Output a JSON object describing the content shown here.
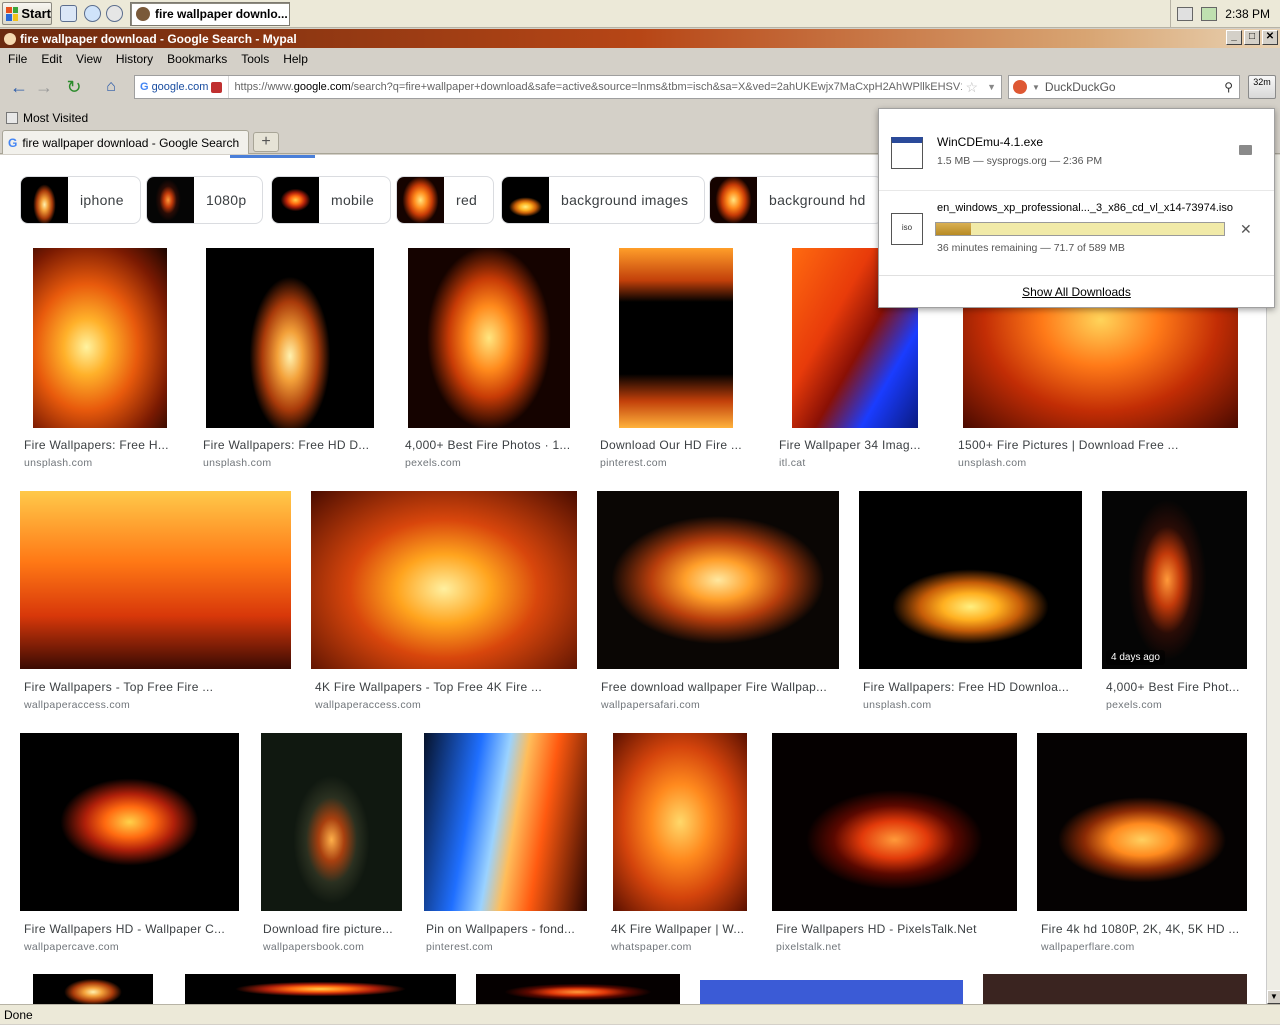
{
  "taskbar": {
    "start_label": "Start",
    "task_label": "fire wallpaper downlo...",
    "clock": "2:38 PM"
  },
  "window": {
    "title": "fire wallpaper download - Google Search - Mypal",
    "min": "_",
    "max": "□",
    "close": "✕"
  },
  "menu": {
    "file": "File",
    "edit": "Edit",
    "view": "View",
    "history": "History",
    "bookmarks": "Bookmarks",
    "tools": "Tools",
    "help": "Help"
  },
  "nav": {
    "site_label": "google.com",
    "url_prefix": "https://www.",
    "url_host": "google.com",
    "url_rest": "/search?q=fire+wallpaper+download&safe=active&source=lnms&tbm=isch&sa=X&ved=2ahUKEwjx7MaCxpH2AhWPllkEHSV1(",
    "search_engine": "DuckDuckGo",
    "download_indicator": "32m"
  },
  "bookmarks": {
    "most_visited": "Most Visited"
  },
  "tabs": {
    "active_label": "fire wallpaper download - Google Search",
    "new_tab": "+"
  },
  "chips": [
    "iphone",
    "1080p",
    "mobile",
    "red",
    "background images",
    "background hd"
  ],
  "results": [
    {
      "caption": "Fire Wallpapers: Free H...",
      "source": "unsplash.com"
    },
    {
      "caption": "Fire Wallpapers: Free HD D...",
      "source": "unsplash.com"
    },
    {
      "caption": "4,000+ Best Fire Photos · 1...",
      "source": "pexels.com"
    },
    {
      "caption": "Download Our HD Fire ...",
      "source": "pinterest.com"
    },
    {
      "caption": "Fire Wallpaper 34 Imag...",
      "source": "itl.cat"
    },
    {
      "caption": "1500+ Fire Pictures | Download Free ...",
      "source": "unsplash.com"
    },
    {
      "caption": "Fire Wallpapers - Top Free Fire ...",
      "source": "wallpaperaccess.com"
    },
    {
      "caption": "4K Fire Wallpapers - Top Free 4K Fire ...",
      "source": "wallpaperaccess.com"
    },
    {
      "caption": "Free download wallpaper Fire Wallpap...",
      "source": "wallpapersafari.com"
    },
    {
      "caption": "Fire Wallpapers: Free HD Downloa...",
      "source": "unsplash.com"
    },
    {
      "caption": "4,000+ Best Fire Phot...",
      "source": "pexels.com",
      "badge": "4 days ago"
    },
    {
      "caption": "Fire Wallpapers HD - Wallpaper C...",
      "source": "wallpapercave.com"
    },
    {
      "caption": "Download fire picture...",
      "source": "wallpapersbook.com"
    },
    {
      "caption": "Pin on Wallpapers - fond...",
      "source": "pinterest.com"
    },
    {
      "caption": "4K Fire Wallpaper | W...",
      "source": "whatspaper.com"
    },
    {
      "caption": "Fire Wallpapers HD - PixelsTalk.Net",
      "source": "pixelstalk.net"
    },
    {
      "caption": "Fire 4k hd 1080P, 2K, 4K, 5K HD ...",
      "source": "wallpaperflare.com"
    }
  ],
  "downloads": {
    "item1_name": "WinCDEmu-4.1.exe",
    "item1_status": "1.5 MB — sysprogs.org — 2:36 PM",
    "item2_name": "en_windows_xp_professional..._3_x86_cd_vl_x14-73974.iso",
    "item2_status": "36 minutes remaining — 71.7 of 589 MB",
    "item2_progress_percent": 12,
    "show_all": "Show All Downloads"
  },
  "status": {
    "text": "Done"
  }
}
